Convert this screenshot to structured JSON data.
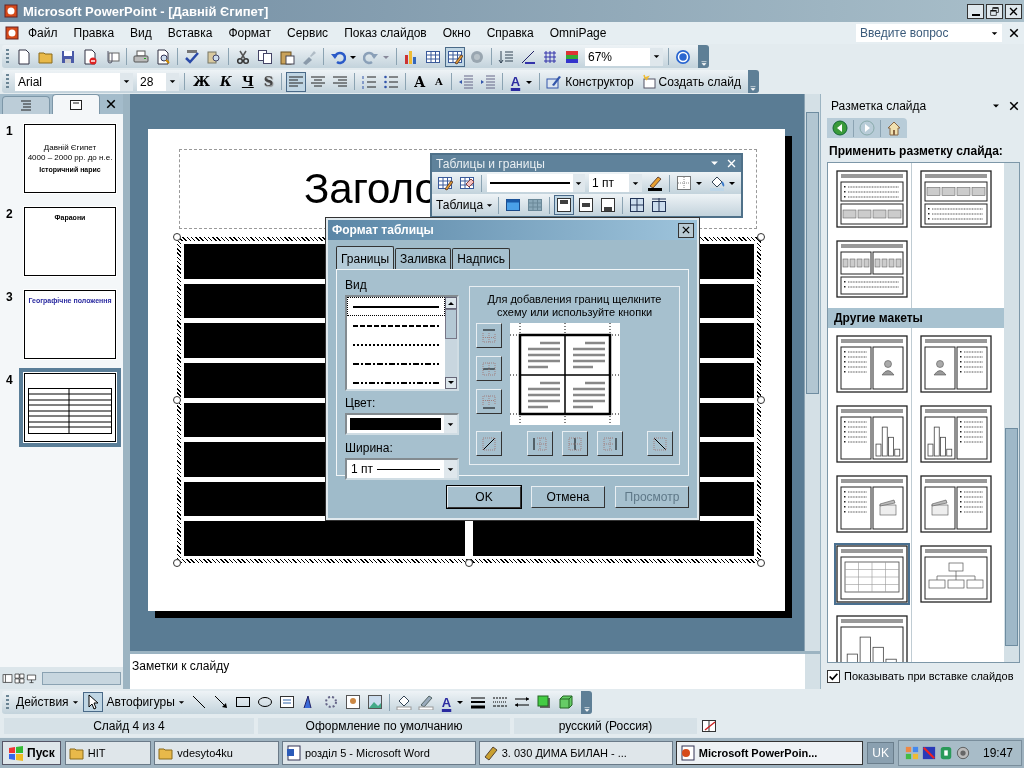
{
  "window": {
    "title": "Microsoft PowerPoint - [Давній Єгипет]"
  },
  "menu": [
    {
      "label": "Файл"
    },
    {
      "label": "Правка"
    },
    {
      "label": "Вид"
    },
    {
      "label": "Вставка"
    },
    {
      "label": "Формат"
    },
    {
      "label": "Сервис"
    },
    {
      "label": "Показ слайдов"
    },
    {
      "label": "Окно"
    },
    {
      "label": "Справка"
    },
    {
      "label": "OmniPage"
    }
  ],
  "help_search": {
    "placeholder": "Введите вопрос"
  },
  "standard_toolbar": {
    "tables_and_borders_on": true,
    "zoom": "67%"
  },
  "formatting_toolbar": {
    "font": "Arial",
    "size": "28",
    "bold": "Ж",
    "italic": "К",
    "underline": "Ч",
    "shadow": "S",
    "align_left_on": true,
    "grow_font": "A",
    "shrink_font": "A",
    "font_color": "A",
    "design": "Конструктор",
    "new_slide": "Создать слайд"
  },
  "pane_tabs": [
    {
      "kind": "outline",
      "selected": false
    },
    {
      "kind": "slides",
      "selected": true
    }
  ],
  "slides": [
    {
      "number": "1",
      "selected": false,
      "kind": "title",
      "lines": [
        "Давній Єгипет",
        "4000 – 2000 рр. до н.е.",
        "Історичний нарис"
      ]
    },
    {
      "number": "2",
      "selected": false,
      "kind": "title_only",
      "lines": [
        "Фараони"
      ]
    },
    {
      "number": "3",
      "selected": false,
      "kind": "colored_title",
      "lines": [
        "Географічне положення"
      ]
    },
    {
      "number": "4",
      "selected": true,
      "kind": "table"
    }
  ],
  "slide": {
    "title": "Заголо",
    "table": {
      "rows": [
        {
          "cells": [
            {
              "filled": true
            },
            {
              "filled": true
            }
          ]
        },
        {
          "cells": [
            {
              "filled": true
            },
            {
              "filled": true
            }
          ]
        },
        {
          "cells": [
            {
              "filled": true
            },
            {
              "filled": true
            }
          ]
        },
        {
          "cells": [
            {
              "filled": true
            },
            {
              "filled": true
            }
          ]
        },
        {
          "cells": [
            {
              "filled": true
            },
            {
              "filled": true
            }
          ]
        },
        {
          "cells": [
            {
              "filled": true
            },
            {
              "filled": true
            }
          ]
        },
        {
          "cells": [
            {
              "filled": true
            },
            {
              "filled": true
            }
          ]
        },
        {
          "cells": [
            {
              "filled": true
            },
            {
              "filled": true
            }
          ]
        }
      ]
    }
  },
  "notes": {
    "placeholder": "Заметки к слайду"
  },
  "tables_toolbar": {
    "title": "Таблицы и границы",
    "line_width": "1 пт",
    "table_menu": "Таблица",
    "top_border_on": true
  },
  "dialog": {
    "title": "Формат таблицы",
    "tabs": [
      {
        "label": "Границы",
        "selected": true
      },
      {
        "label": "Заливка",
        "selected": false
      },
      {
        "label": "Надпись",
        "selected": false
      }
    ],
    "style_label": "Вид",
    "line_styles": [
      {
        "kind": "solid",
        "selected": true
      },
      {
        "kind": "dashed",
        "selected": false
      },
      {
        "kind": "dotted",
        "selected": false
      },
      {
        "kind": "dash_dot",
        "selected": false
      },
      {
        "kind": "dash_dot_dot",
        "selected": false
      }
    ],
    "color_label": "Цвет:",
    "width_label": "Ширина:",
    "width_value": "1 пт",
    "hint": "Для добавления границ щелкните схему или используйте кнопки",
    "buttons": [
      {
        "label": "OK",
        "disabled": false,
        "default": true
      },
      {
        "label": "Отмена",
        "disabled": false,
        "default": false
      },
      {
        "label": "Просмотр",
        "disabled": true,
        "default": false
      }
    ]
  },
  "task_pane": {
    "title": "Разметка слайда",
    "apply_heading": "Применить разметку слайда:",
    "layouts": [
      {
        "kind": "text_over_content",
        "selected": false
      },
      {
        "kind": "content_over_text",
        "selected": false
      },
      {
        "kind": "two_content_over_text",
        "selected": false
      }
    ],
    "other_heading": "Другие макеты",
    "other_layouts": [
      {
        "kind": "text_and_picture",
        "selected": false
      },
      {
        "kind": "picture_and_text",
        "selected": false
      },
      {
        "kind": "text_and_chart",
        "selected": false
      },
      {
        "kind": "chart_and_text",
        "selected": false
      },
      {
        "kind": "text_and_media",
        "selected": false
      },
      {
        "kind": "media_and_text",
        "selected": false
      },
      {
        "kind": "table",
        "selected": true
      },
      {
        "kind": "org_chart",
        "selected": false
      },
      {
        "kind": "chart",
        "selected": false
      }
    ],
    "show_on_insert": {
      "label": "Показывать при вставке слайдов",
      "checked": true
    }
  },
  "drawing_toolbar": {
    "actions": "Действия",
    "select_on": true,
    "autoshapes": "Автофигуры",
    "font_color": "A"
  },
  "status_bar": [
    "Слайд 4 из 4",
    "Оформление по умолчанию",
    "русский (Россия)"
  ],
  "taskbar": {
    "start": "Пуск",
    "tasks": [
      {
        "label": "HIT",
        "kind": "folder",
        "selected": false
      },
      {
        "label": "vdesyto4ku",
        "kind": "folder",
        "selected": false
      },
      {
        "label": "розділ 5 - Microsoft Word",
        "kind": "word",
        "selected": false
      },
      {
        "label": "3. 030 ДИМА БИЛАН - ...",
        "kind": "player",
        "selected": false
      },
      {
        "label": "Microsoft PowerPoin...",
        "kind": "powerpoint",
        "selected": true
      }
    ],
    "language": "UK",
    "time": "19:47"
  }
}
